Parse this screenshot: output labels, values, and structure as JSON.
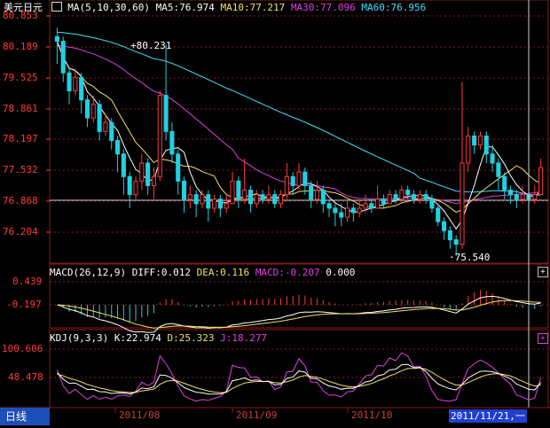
{
  "symbol_title": "美元日元",
  "ma_header": {
    "params": "MA(5,10,30,60)",
    "ma5": "MA5:76.974",
    "ma10": "MA10:77.217",
    "ma30": "MA30:77.096",
    "ma60": "MA60:76.956"
  },
  "price_axis_labels": [
    "80.853",
    "80.189",
    "79.525",
    "78.861",
    "78.197",
    "77.532",
    "76.868",
    "76.204"
  ],
  "annotations": {
    "high": "80.231",
    "low": "75.540"
  },
  "macd_header": {
    "params": "MACD(26,12,9)",
    "diff": "DIFF:0.012",
    "dea": "DEA:0.116",
    "macd": "MACD:-0.207",
    "zero": "0.000"
  },
  "macd_axis_labels": [
    "0.439",
    "-0.197"
  ],
  "kdj_header": {
    "params": "KDJ(9,3,3)",
    "k": "K:22.974",
    "d": "D:25.323",
    "j": "J:18.277"
  },
  "kdj_axis_labels": [
    "100.606",
    "48.478"
  ],
  "x_axis_months": [
    "2011/08",
    "2011/09",
    "2011/10"
  ],
  "cursor_date": "2011/11/21,一",
  "period_label": "日线",
  "panel_buttons": {
    "macd": "+",
    "kdj": "+"
  },
  "colors": {
    "up": "#ff3b3b",
    "down": "#20d0e0",
    "ma5": "#ffffff",
    "ma10": "#f0e060",
    "ma30": "#e040e0",
    "ma60": "#40e0ff",
    "grid": "#8a1818",
    "cursor_date_bg": "#1f3fcf",
    "period_bg": "#1e4fb8"
  },
  "chart_data": {
    "type": "candlestick",
    "price_range": [
      75.4,
      80.9
    ],
    "candles": [
      [
        80.4,
        80.3,
        80.6,
        79.8
      ],
      [
        80.3,
        79.6,
        80.4,
        79.4
      ],
      [
        79.6,
        79.2,
        79.7,
        78.9
      ],
      [
        79.2,
        79.5,
        79.7,
        79.1
      ],
      [
        79.5,
        79.0,
        79.6,
        78.7
      ],
      [
        79.0,
        78.6,
        79.1,
        78.4
      ],
      [
        78.6,
        78.9,
        79.1,
        78.5
      ],
      [
        78.9,
        78.3,
        79.0,
        78.1
      ],
      [
        78.3,
        78.5,
        78.7,
        78.2
      ],
      [
        78.5,
        78.1,
        78.6,
        77.9
      ],
      [
        78.1,
        77.8,
        78.2,
        77.4
      ],
      [
        77.8,
        77.3,
        77.9,
        76.9
      ],
      [
        77.3,
        76.9,
        77.4,
        76.6
      ],
      [
        76.9,
        77.2,
        77.3,
        76.8
      ],
      [
        77.2,
        77.6,
        77.8,
        77.0
      ],
      [
        77.6,
        77.1,
        77.7,
        76.9
      ],
      [
        77.1,
        77.3,
        77.5,
        76.8
      ],
      [
        77.3,
        79.1,
        79.2,
        77.2
      ],
      [
        79.1,
        78.3,
        80.231,
        78.1
      ],
      [
        78.3,
        77.8,
        78.5,
        77.6
      ],
      [
        77.8,
        77.2,
        77.9,
        76.9
      ],
      [
        77.2,
        76.8,
        77.3,
        76.5
      ],
      [
        76.8,
        76.9,
        77.1,
        76.6
      ],
      [
        76.9,
        76.7,
        77.0,
        76.4
      ],
      [
        76.7,
        76.9,
        77.0,
        76.6
      ],
      [
        76.9,
        76.6,
        77.0,
        76.3
      ],
      [
        76.6,
        76.8,
        76.9,
        76.5
      ],
      [
        76.8,
        76.6,
        76.9,
        76.4
      ],
      [
        76.6,
        76.7,
        76.9,
        76.5
      ],
      [
        76.7,
        77.2,
        77.4,
        76.7
      ],
      [
        77.2,
        76.8,
        77.3,
        76.6
      ],
      [
        76.8,
        77.0,
        77.7,
        76.7
      ],
      [
        77.0,
        76.7,
        77.1,
        76.5
      ],
      [
        76.7,
        76.9,
        77.0,
        76.6
      ],
      [
        76.9,
        76.8,
        77.0,
        76.7
      ],
      [
        76.8,
        76.9,
        77.1,
        76.7
      ],
      [
        76.9,
        76.7,
        77.0,
        76.6
      ],
      [
        76.7,
        76.9,
        77.0,
        76.6
      ],
      [
        76.9,
        77.3,
        77.6,
        76.8
      ],
      [
        77.3,
        77.1,
        77.4,
        76.9
      ],
      [
        77.1,
        77.4,
        77.6,
        77.0
      ],
      [
        77.4,
        77.1,
        77.5,
        76.9
      ],
      [
        77.1,
        76.8,
        77.2,
        76.6
      ],
      [
        76.8,
        77.0,
        77.2,
        76.7
      ],
      [
        77.0,
        76.7,
        77.1,
        76.5
      ],
      [
        76.7,
        76.6,
        76.8,
        76.4
      ],
      [
        76.6,
        76.5,
        76.7,
        76.2
      ],
      [
        76.5,
        76.4,
        76.7,
        76.2
      ],
      [
        76.4,
        76.6,
        76.8,
        76.3
      ],
      [
        76.6,
        76.5,
        76.7,
        76.3
      ],
      [
        76.5,
        76.6,
        76.8,
        76.4
      ],
      [
        76.6,
        76.7,
        76.9,
        76.5
      ],
      [
        76.7,
        76.6,
        76.8,
        76.5
      ],
      [
        76.6,
        76.8,
        77.1,
        76.6
      ],
      [
        76.8,
        76.7,
        76.9,
        76.6
      ],
      [
        76.7,
        76.9,
        77.0,
        76.7
      ],
      [
        76.9,
        76.8,
        77.0,
        76.7
      ],
      [
        76.8,
        77.0,
        77.1,
        76.7
      ],
      [
        77.0,
        76.9,
        77.1,
        76.8
      ],
      [
        76.9,
        76.8,
        77.0,
        76.7
      ],
      [
        76.8,
        76.9,
        77.0,
        76.7
      ],
      [
        76.9,
        76.8,
        77.0,
        76.7
      ],
      [
        76.8,
        76.6,
        76.9,
        76.5
      ],
      [
        76.6,
        76.3,
        76.7,
        76.2
      ],
      [
        76.3,
        76.1,
        76.4,
        75.9
      ],
      [
        76.1,
        75.9,
        76.2,
        75.7
      ],
      [
        75.9,
        75.8,
        76.0,
        75.54
      ],
      [
        75.8,
        77.6,
        79.4,
        75.7
      ],
      [
        77.6,
        78.2,
        78.4,
        77.4
      ],
      [
        78.2,
        78.0,
        78.3,
        77.8
      ],
      [
        78.0,
        78.2,
        78.3,
        77.9
      ],
      [
        78.2,
        77.8,
        78.3,
        77.6
      ],
      [
        77.8,
        77.6,
        78.0,
        77.4
      ],
      [
        77.6,
        77.3,
        77.7,
        77.0
      ],
      [
        77.3,
        77.0,
        77.4,
        76.8
      ],
      [
        77.0,
        76.9,
        77.1,
        76.7
      ],
      [
        76.9,
        76.8,
        77.0,
        76.6
      ],
      [
        76.8,
        76.9,
        77.1,
        76.7
      ],
      [
        76.9,
        76.8,
        77.0,
        76.7
      ],
      [
        76.8,
        76.9,
        77.1,
        76.7
      ],
      [
        76.9,
        77.5,
        77.7,
        76.9
      ]
    ]
  }
}
